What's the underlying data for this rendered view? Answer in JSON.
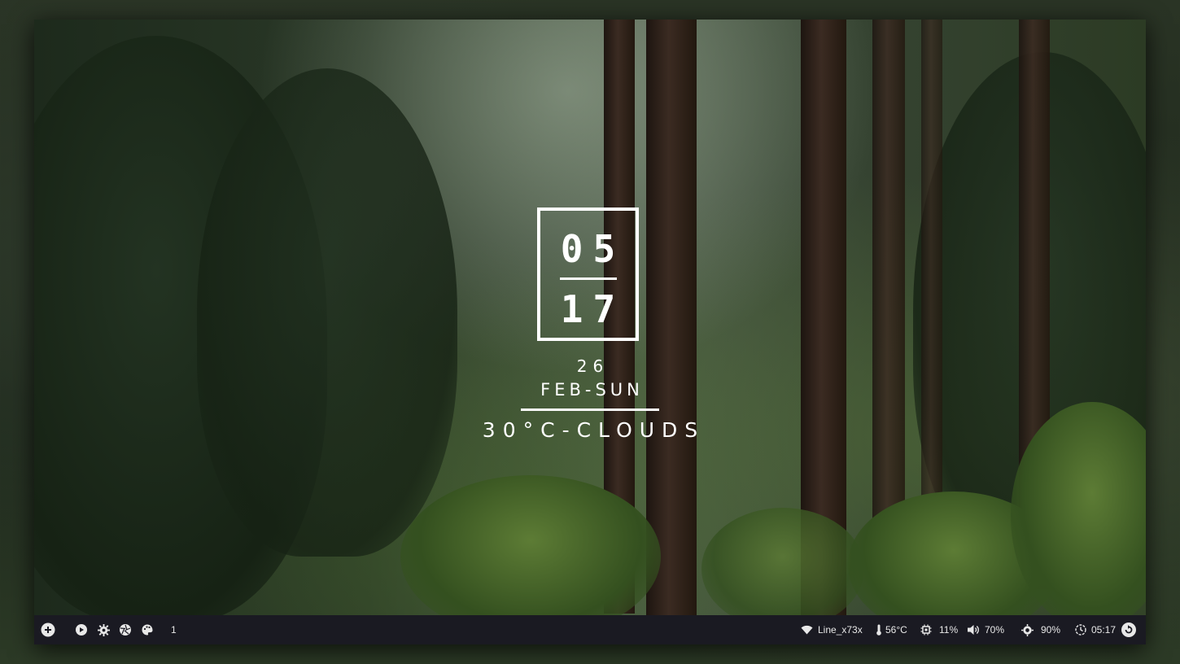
{
  "clock": {
    "hour": "05",
    "minute": "17"
  },
  "date": {
    "day": "26",
    "month_weekday": "FEB-SUN"
  },
  "weather": {
    "text": "30°C-CLOUDS"
  },
  "bar": {
    "left": {
      "workspace": "1",
      "icons": [
        "add-icon",
        "play-icon",
        "settings-icon",
        "aperture-icon",
        "palette-icon"
      ]
    },
    "right": {
      "wifi": {
        "icon": "wifi-icon",
        "label": "Line_x73x"
      },
      "temp": {
        "icon": "thermometer-icon",
        "label": "56°C"
      },
      "cpu": {
        "icon": "cpu-icon",
        "label": "11%"
      },
      "volume": {
        "icon": "volume-icon",
        "label": "70%"
      },
      "brightness": {
        "icon": "brightness-icon",
        "label": "90%"
      },
      "time": {
        "icon": "clock-icon",
        "label": "05:17"
      },
      "power": {
        "icon": "power-icon"
      }
    }
  },
  "colors": {
    "bar_bg": "#1a1a22",
    "text": "#ffffff",
    "accent": "#e8e8e8"
  }
}
